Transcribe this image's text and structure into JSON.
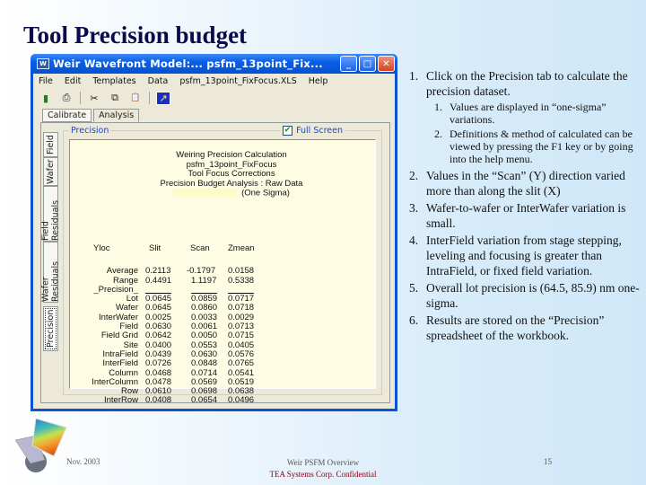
{
  "slide": {
    "title": "Tool Precision budget",
    "footer": {
      "date": "Nov. 2003",
      "center_line1": "Weir PSFM Overview",
      "center_line2": "TEA Systems Corp. Confidential",
      "page_number": "15"
    }
  },
  "window": {
    "app_icon": "app-icon",
    "title": "Weir Wavefront Model:...  psfm_13point_Fix...",
    "controls": {
      "minimize": "_",
      "maximize": "□",
      "close": "✕"
    },
    "menu": [
      "File",
      "Edit",
      "Templates",
      "Data",
      "psfm_13point_FixFocus.XLS",
      "Help"
    ],
    "toolbar": [
      {
        "icon": "open-book-icon",
        "glyph": "▮"
      },
      {
        "icon": "print-icon",
        "glyph": "⎙"
      },
      {
        "icon": "cut-icon",
        "glyph": "✂"
      },
      {
        "icon": "copy-icon",
        "glyph": "⧉"
      },
      {
        "icon": "paste-icon",
        "glyph": "📋"
      },
      {
        "icon": "run-arrow-icon",
        "glyph": "↗"
      }
    ],
    "top_tabs": [
      "Calibrate",
      "Analysis"
    ],
    "active_top_tab": "Analysis",
    "side_tabs": [
      "Field",
      "Wafer",
      "Field Residuals",
      "Wafer Residuals",
      "Precision"
    ],
    "active_side_tab": "Precision",
    "group_label": "Precision",
    "full_screen": {
      "label": "Full Screen",
      "checked": true,
      "check_glyph": "✔"
    },
    "heading_lines": [
      "Weiring Precision Calculation",
      "psfm_13point_FixFocus",
      "Tool Focus Corrections",
      "Precision Budget Analysis : Raw Data",
      "(One Sigma)"
    ],
    "table": {
      "columns": [
        "Yloc",
        "Slit",
        "Scan",
        "Zmean"
      ],
      "summary_rows": [
        {
          "label": "Average",
          "values": [
            "0.2113",
            "-0.1797",
            "0.0158"
          ]
        },
        {
          "label": "Range",
          "values": [
            "0.4491",
            "1.1197",
            "0.5338"
          ]
        }
      ],
      "section_label": "_Precision_",
      "precision_rows": [
        {
          "label": "Lot",
          "values": [
            "0.0645",
            "0.0859",
            "0.0717"
          ]
        },
        {
          "label": "Wafer",
          "values": [
            "0.0645",
            "0.0860",
            "0.0718"
          ]
        },
        {
          "label": "InterWafer",
          "values": [
            "0.0025",
            "0.0033",
            "0.0029"
          ]
        },
        {
          "label": "Field",
          "values": [
            "0.0630",
            "0.0061",
            "0.0713"
          ]
        },
        {
          "label": "Field Grid",
          "values": [
            "0.0642",
            "0.0050",
            "0.0715"
          ]
        },
        {
          "label": "Site",
          "values": [
            "0.0400",
            "0.0553",
            "0.0405"
          ]
        },
        {
          "label": "IntraField",
          "values": [
            "0.0439",
            "0.0630",
            "0.0576"
          ]
        },
        {
          "label": "InterField",
          "values": [
            "0.0726",
            "0.0848",
            "0.0765"
          ]
        },
        {
          "label": "Column",
          "values": [
            "0.0468",
            "0.0714",
            "0.0541"
          ]
        },
        {
          "label": "InterColumn",
          "values": [
            "0.0478",
            "0.0569",
            "0.0519"
          ]
        },
        {
          "label": "Row",
          "values": [
            "0.0610",
            "0.0698",
            "0.0638"
          ]
        },
        {
          "label": "InterRow",
          "values": [
            "0.0408",
            "0.0654",
            "0.0496"
          ]
        }
      ]
    }
  },
  "bullets": [
    {
      "n": "1.",
      "text": "Click on the Precision tab to calculate the precision dataset.",
      "sub": [
        {
          "n": "1.",
          "text": "Values are displayed in “one-sigma” variations."
        },
        {
          "n": "2.",
          "text": "Definitions & method of calculated can be viewed by pressing the F1 key or by going into the help menu."
        }
      ]
    },
    {
      "n": "2.",
      "text": "Values in the “Scan” (Y) direction varied more than along the slit (X)"
    },
    {
      "n": "3.",
      "text": "Wafer-to-wafer or InterWafer variation is small."
    },
    {
      "n": "4.",
      "text": "InterField variation from stage stepping, leveling and focusing is greater than IntraField, or fixed field variation."
    },
    {
      "n": "5.",
      "text": "Overall lot precision is (64.5, 85.9) nm one-sigma."
    },
    {
      "n": "6.",
      "text": "Results are stored on the “Precision” spreadsheet of the workbook."
    }
  ],
  "colors": {
    "title": "#0b0b4a",
    "window_frame": "#0a52d6",
    "panel_bg": "#fefde4",
    "group_label": "#2146c8",
    "footer_confidential": "#7a0010"
  }
}
